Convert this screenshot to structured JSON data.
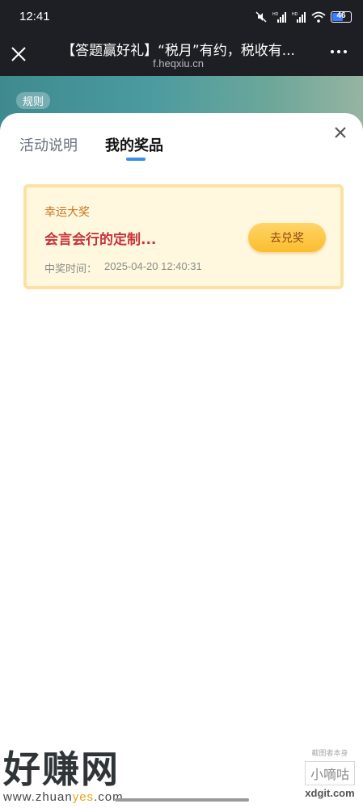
{
  "status_bar": {
    "time": "12:41",
    "battery_level": "46",
    "icons": [
      "mute-icon",
      "signal-hd-icon",
      "signal-hd-icon",
      "wifi-icon",
      "battery-icon"
    ]
  },
  "nav": {
    "title": "【答题赢好礼】“税月”有约，税收有...",
    "url": "f.heqxiu.cn"
  },
  "banner": {
    "rule_tag": "规则"
  },
  "sheet": {
    "tabs": [
      {
        "label": "活动说明",
        "active": false
      },
      {
        "label": "我的奖品",
        "active": true
      }
    ],
    "accent_color": "#3a8ee8"
  },
  "prize": {
    "category": "幸运大奖",
    "name": "会言会行的定制...",
    "time_label": "中奖时间：",
    "time_value": "2025-04-20 12:40:31",
    "button_label": "去兑奖"
  },
  "watermark": {
    "brand": "好赚网",
    "url_prefix": "www.zhuan",
    "url_highlight": "yes",
    "url_suffix": ".com",
    "right_top": "截图者本身",
    "right_box": "小嘀咕",
    "right_domain": "xdgit.com"
  }
}
